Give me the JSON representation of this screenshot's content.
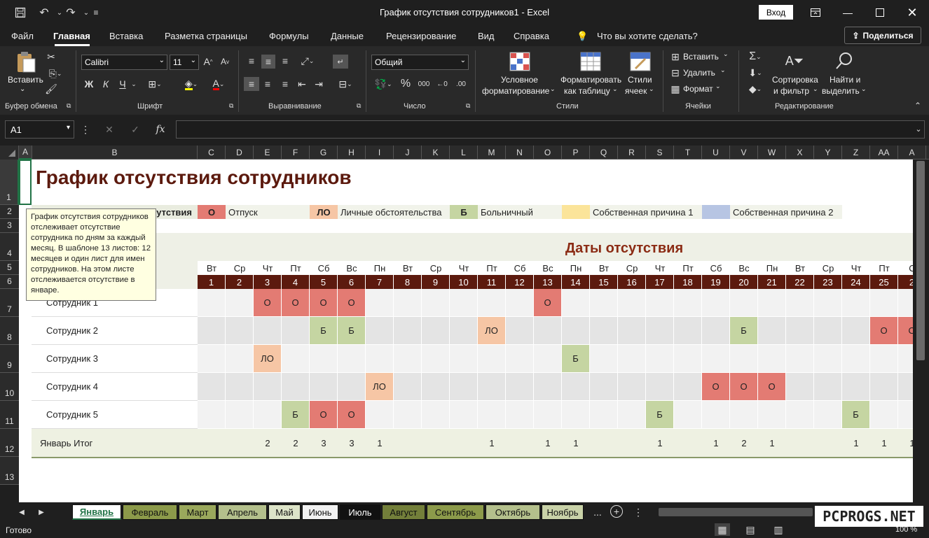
{
  "titlebar": {
    "title": "График отсутствия сотрудников1  -  Excel",
    "login": "Вход"
  },
  "menu": {
    "items": [
      "Файл",
      "Главная",
      "Вставка",
      "Разметка страницы",
      "Формулы",
      "Данные",
      "Рецензирование",
      "Вид",
      "Справка"
    ],
    "tell_me": "Что вы хотите сделать?",
    "share": "Поделиться"
  },
  "ribbon": {
    "clipboard": {
      "paste": "Вставить",
      "group": "Буфер обмена"
    },
    "font": {
      "name": "Calibri",
      "size": "11",
      "bold": "Ж",
      "italic": "К",
      "underline": "Ч",
      "group": "Шрифт"
    },
    "alignment": {
      "group": "Выравнивание"
    },
    "number": {
      "format": "Общий",
      "percent": "%",
      "thousands": "000",
      "group": "Число"
    },
    "styles": {
      "conditional": [
        "Условное",
        "форматирование"
      ],
      "table": [
        "Форматировать",
        "как таблицу"
      ],
      "cell": [
        "Стили",
        "ячеек"
      ],
      "group": "Стили"
    },
    "cells": {
      "insert": "Вставить",
      "delete": "Удалить",
      "format": "Формат",
      "group": "Ячейки"
    },
    "editing": {
      "sort": [
        "Сортировка",
        "и фильтр"
      ],
      "find": [
        "Найти и",
        "выделить"
      ],
      "group": "Редактирование"
    }
  },
  "formula_bar": {
    "name_box": "A1",
    "fx": "fx"
  },
  "columns": [
    "A",
    "B",
    "C",
    "D",
    "E",
    "F",
    "G",
    "H",
    "I",
    "J",
    "K",
    "L",
    "M",
    "N",
    "O",
    "P",
    "Q",
    "R",
    "S",
    "T",
    "U",
    "V",
    "W",
    "X",
    "Y",
    "Z",
    "AA",
    "A"
  ],
  "rows": [
    "1",
    "2",
    "3",
    "4",
    "5",
    "6",
    "7",
    "8",
    "9",
    "10",
    "11",
    "12",
    "13"
  ],
  "sheet": {
    "title": "График отсутствия сотрудников",
    "legend_partial": "утствия",
    "legend": [
      {
        "code": "О",
        "label": "Отпуск",
        "color": "#e37b73"
      },
      {
        "code": "ЛО",
        "label": "Личные обстоятельства",
        "color": "#f6c6a5"
      },
      {
        "code": "Б",
        "label": "Больничный",
        "color": "#c5d5a2"
      },
      {
        "code": "",
        "label": "Собственная причина 1",
        "color": "#fbe49a"
      },
      {
        "code": "",
        "label": "Собственная причина 2",
        "color": "#b7c5e3"
      }
    ],
    "dates_header": "Даты отсутствия",
    "weekdays": [
      "Вт",
      "Ср",
      "Чт",
      "Пт",
      "Сб",
      "Вс",
      "Пн",
      "Вт",
      "Ср",
      "Чт",
      "Пт",
      "Сб",
      "Вс",
      "Пн",
      "Вт",
      "Ср",
      "Чт",
      "Пт",
      "Сб",
      "Вс",
      "Пн",
      "Вт",
      "Ср",
      "Чт",
      "Пт",
      "С"
    ],
    "days": [
      "1",
      "2",
      "3",
      "4",
      "5",
      "6",
      "7",
      "8",
      "9",
      "10",
      "11",
      "12",
      "13",
      "14",
      "15",
      "16",
      "17",
      "18",
      "19",
      "20",
      "21",
      "22",
      "23",
      "24",
      "25",
      "2"
    ],
    "employees": [
      {
        "name": "Сотрудник 1",
        "marks": {
          "3": "О",
          "4": "О",
          "5": "О",
          "6": "О",
          "13": "О"
        }
      },
      {
        "name": "Сотрудник 2",
        "marks": {
          "5": "Б",
          "6": "Б",
          "11": "ЛО",
          "20": "Б",
          "25": "О",
          "26": "О"
        }
      },
      {
        "name": "Сотрудник 3",
        "marks": {
          "3": "ЛО",
          "14": "Б"
        }
      },
      {
        "name": "Сотрудник 4",
        "marks": {
          "7": "ЛО",
          "19": "О",
          "20": "О",
          "21": "О"
        }
      },
      {
        "name": "Сотрудник 5",
        "marks": {
          "4": "Б",
          "5": "О",
          "6": "О",
          "17": "Б",
          "24": "Б"
        }
      }
    ],
    "total_label": "Январь Итог",
    "totals": [
      "",
      "",
      "2",
      "2",
      "3",
      "3",
      "1",
      "",
      "",
      "",
      "1",
      "",
      "1",
      "1",
      "",
      "",
      "1",
      "",
      "1",
      "2",
      "1",
      "",
      "",
      "1",
      "1",
      "1"
    ]
  },
  "tooltip": "График отсутствия сотрудников отслеживает отсутствие сотрудника по дням за каждый месяц. В шаблоне 13 листов: 12 месяцев и один лист для имен сотрудников. На этом листе отслеживается отсутствие в январе.",
  "tabs": [
    {
      "label": "Январь",
      "bg": "#ffffff",
      "fg": "#217346",
      "active": true
    },
    {
      "label": "Февраль",
      "bg": "#8c9a4a",
      "fg": "#111111"
    },
    {
      "label": "Март",
      "bg": "#9aa85c",
      "fg": "#111111"
    },
    {
      "label": "Апрель",
      "bg": "#b4c08c",
      "fg": "#111111"
    },
    {
      "label": "Май",
      "bg": "#dde4c8",
      "fg": "#111111"
    },
    {
      "label": "Июнь",
      "bg": "#f2f2f2",
      "fg": "#111111"
    },
    {
      "label": "Июль",
      "bg": "#111111",
      "fg": "#ffffff"
    },
    {
      "label": "Август",
      "bg": "#737f3a",
      "fg": "#111111"
    },
    {
      "label": "Сентябрь",
      "bg": "#8c9a4a",
      "fg": "#111111"
    },
    {
      "label": "Октябрь",
      "bg": "#b4c08c",
      "fg": "#111111"
    },
    {
      "label": "Ноябрь",
      "bg": "#c9d2a8",
      "fg": "#111111"
    }
  ],
  "tab_more": "...",
  "status": {
    "ready": "Готово",
    "zoom": "100 %"
  },
  "watermark": "PCPROGS.NET"
}
